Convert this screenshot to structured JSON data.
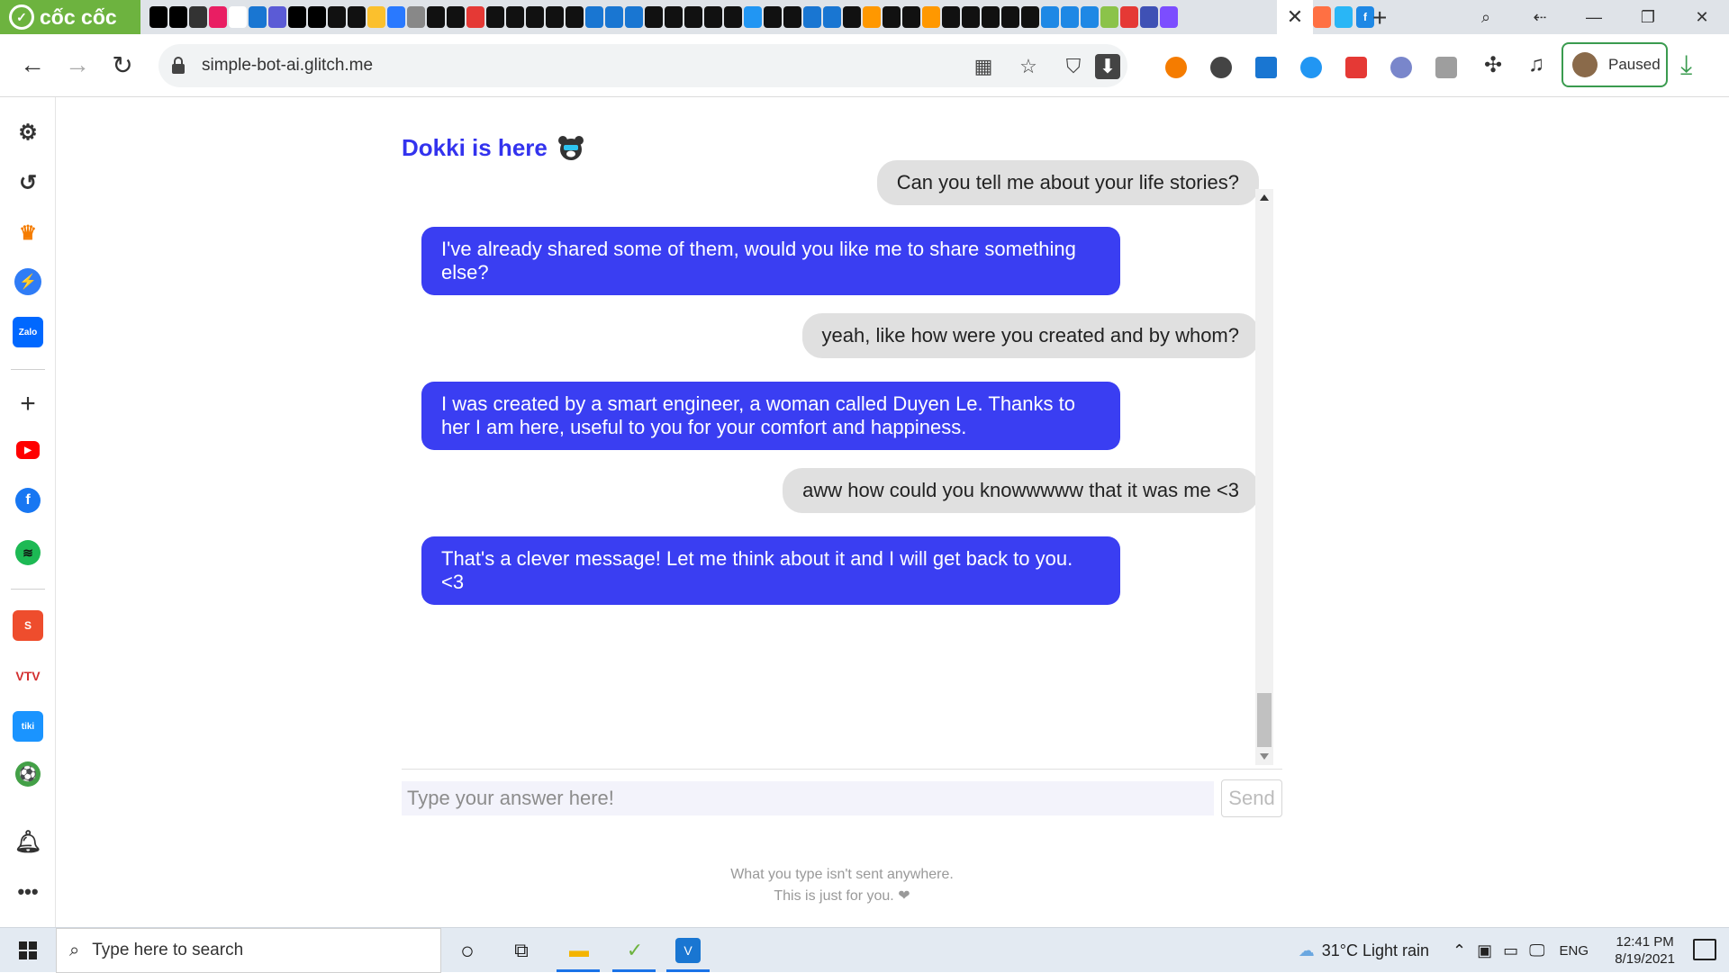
{
  "browser": {
    "brand": "cốc cốc",
    "url": "simple-bot-ai.glitch.me",
    "profile_status": "Paused",
    "tab_colors": [
      "#000000",
      "#000000",
      "#333333",
      "#e91e63",
      "#ffffff",
      "#1976d2",
      "#5b5bd6",
      "#000000",
      "#000000",
      "#111111",
      "#111111",
      "#fbc02d",
      "#2979ff",
      "#888888",
      "#111111",
      "#111111",
      "#e53935",
      "#111111",
      "#111111",
      "#111111",
      "#111111",
      "#111111",
      "#1976d2",
      "#1976d2",
      "#1976d2",
      "#111111",
      "#111111",
      "#111111",
      "#111111",
      "#111111",
      "#2196f3",
      "#111111",
      "#111111",
      "#1976d2",
      "#1976d2",
      "#111111",
      "#ff9800",
      "#111111",
      "#111111",
      "#ff9800",
      "#111111",
      "#111111",
      "#111111",
      "#111111",
      "#111111",
      "#1e88e5",
      "#1e88e5",
      "#1e88e5",
      "#8bc34a",
      "#e53935",
      "#3f51b5",
      "#7c4dff"
    ]
  },
  "chat": {
    "title": "Dokki is here",
    "messages": [
      {
        "from": "user",
        "text": "Can you tell me about your life stories?"
      },
      {
        "from": "bot",
        "text": "I've already shared some of them, would you like me to share something else?"
      },
      {
        "from": "user",
        "text": "yeah, like how were you created and by whom?"
      },
      {
        "from": "bot",
        "text": "I was created by a smart engineer, a woman called Duyen Le. Thanks to her I am here, useful to you for your comfort and happiness."
      },
      {
        "from": "user",
        "text": "aww how could you knowwwww that it was me <3"
      },
      {
        "from": "bot",
        "text": "That's a clever message! Let me think about it and I will get back to you. <3"
      }
    ],
    "input_placeholder": "Type your answer here!",
    "send_label": "Send",
    "footer_line1": "What you type isn't sent anywhere.",
    "footer_line2": "This is just for you. ❤"
  },
  "taskbar": {
    "search_placeholder": "Type here to search",
    "weather": "31°C  Light rain",
    "language": "ENG",
    "time": "12:41 PM",
    "date": "8/19/2021"
  },
  "colors": {
    "accent": "#3a3ef2",
    "title": "#3333ee",
    "brand": "#6db33f"
  }
}
